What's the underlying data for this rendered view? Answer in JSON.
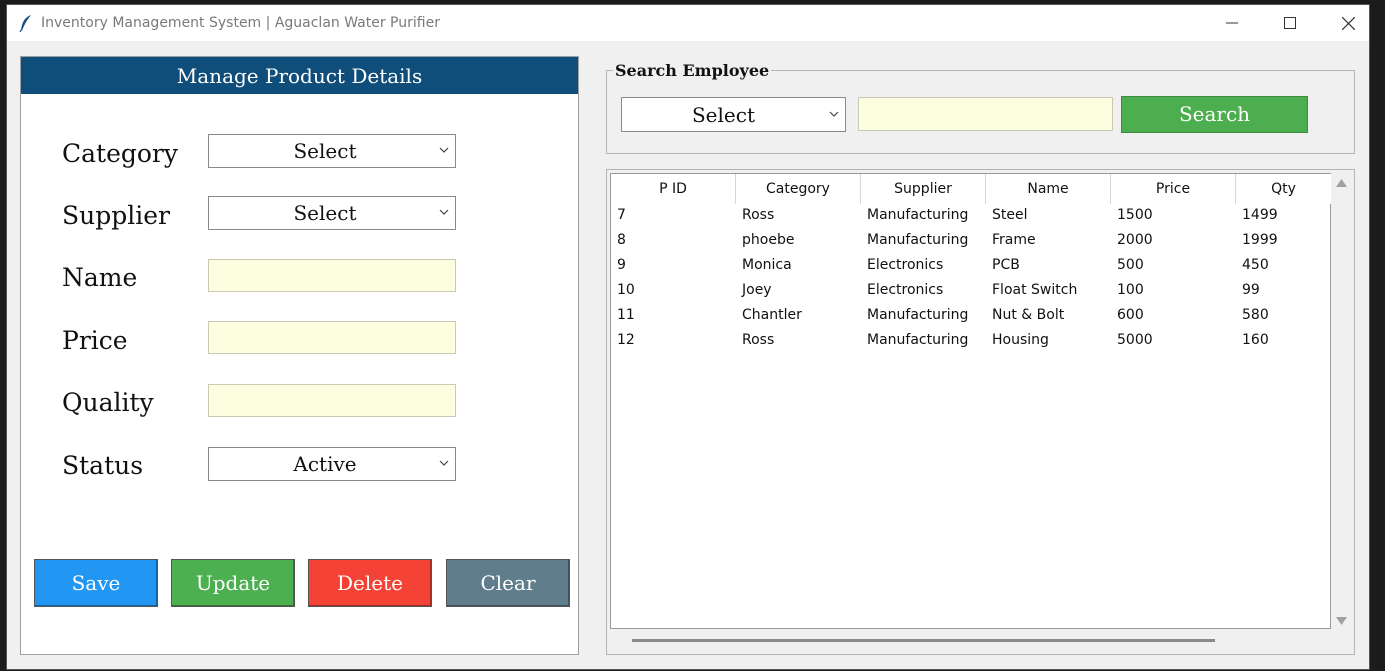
{
  "window": {
    "title": "Inventory Management System | Aguaclan Water Purifier",
    "icon": "feather-icon"
  },
  "form": {
    "header": "Manage Product Details",
    "labels": {
      "category": "Category",
      "supplier": "Supplier",
      "name": "Name",
      "price": "Price",
      "quality": "Quality",
      "status": "Status"
    },
    "values": {
      "category": "Select",
      "supplier": "Select",
      "name": "",
      "price": "",
      "quality": "",
      "status": "Active"
    },
    "buttons": {
      "save": "Save",
      "update": "Update",
      "delete": "Delete",
      "clear": "Clear"
    }
  },
  "search": {
    "legend": "Search Employee",
    "select_value": "Select",
    "text_value": "",
    "button": "Search"
  },
  "table": {
    "columns": [
      "P ID",
      "Category",
      "Supplier",
      "Name",
      "Price",
      "Qty"
    ],
    "rows": [
      [
        "7",
        "Ross",
        "Manufacturing",
        "Steel",
        "1500",
        "1499"
      ],
      [
        "8",
        "phoebe",
        "Manufacturing",
        "Frame",
        "2000",
        "1999"
      ],
      [
        "9",
        "Monica",
        "Electronics",
        "PCB",
        "500",
        "450"
      ],
      [
        "10",
        "Joey",
        "Electronics",
        "Float Switch",
        "100",
        "99"
      ],
      [
        "11",
        "Chantler",
        "Manufacturing",
        "Nut & Bolt",
        "600",
        "580"
      ],
      [
        "12",
        "Ross",
        "Manufacturing",
        "Housing",
        "5000",
        "160"
      ]
    ]
  },
  "colors": {
    "header_bg": "#0f4d7a",
    "save": "#2196f3",
    "update": "#4caf50",
    "delete": "#f44336",
    "clear": "#607d8b",
    "search": "#4cae4f",
    "entry_bg": "#fdfde0"
  }
}
